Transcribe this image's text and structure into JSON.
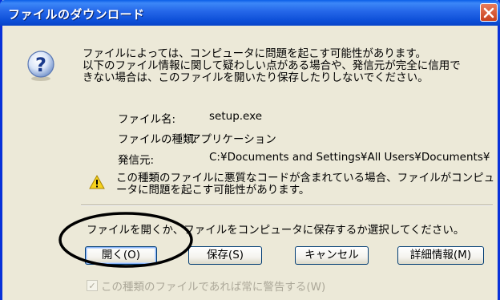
{
  "window": {
    "title": "ファイルのダウンロード"
  },
  "icons": {
    "title_close": "close-icon",
    "main": "question-icon",
    "warning": "warning-icon",
    "checkbox": "checkbox-checked-icon"
  },
  "intro_lines": [
    "ファイルによっては、コンピュータに問題を起こす可能性があります。",
    "以下のファイル情報に関して疑わしい点がある場合や、発信元が完全に信用で",
    "きない場合は、このファイルを開いたり保存したりしないでください。"
  ],
  "file_info": {
    "name_label": "ファイル名:",
    "name_value": "setup.exe",
    "type_label": "ファイルの種類:",
    "type_value": "アプリケーション",
    "source_label": "発信元:",
    "source_value": "C:¥Documents and Settings¥All Users¥Documents¥"
  },
  "warning_lines": [
    "この種類のファイルに悪質なコードが含まれている場合、ファイルがコンピュ",
    "ータに問題を起こす可能性があります。"
  ],
  "prompt": "ファイルを開くか、ファイルをコンピュータに保存するか選択してください。",
  "buttons": {
    "open": "開く(O)",
    "save": "保存(S)",
    "cancel": "キャンセル",
    "details": "詳細情報(M)"
  },
  "checkbox": {
    "label": "この種類のファイルであれば常に警告する(W)",
    "checked": true
  },
  "colors": {
    "titlebar": "#0a5fe8",
    "dialog_bg": "#ece9d8",
    "close_button": "#d4582c",
    "annotation_ellipse": "#000000"
  }
}
